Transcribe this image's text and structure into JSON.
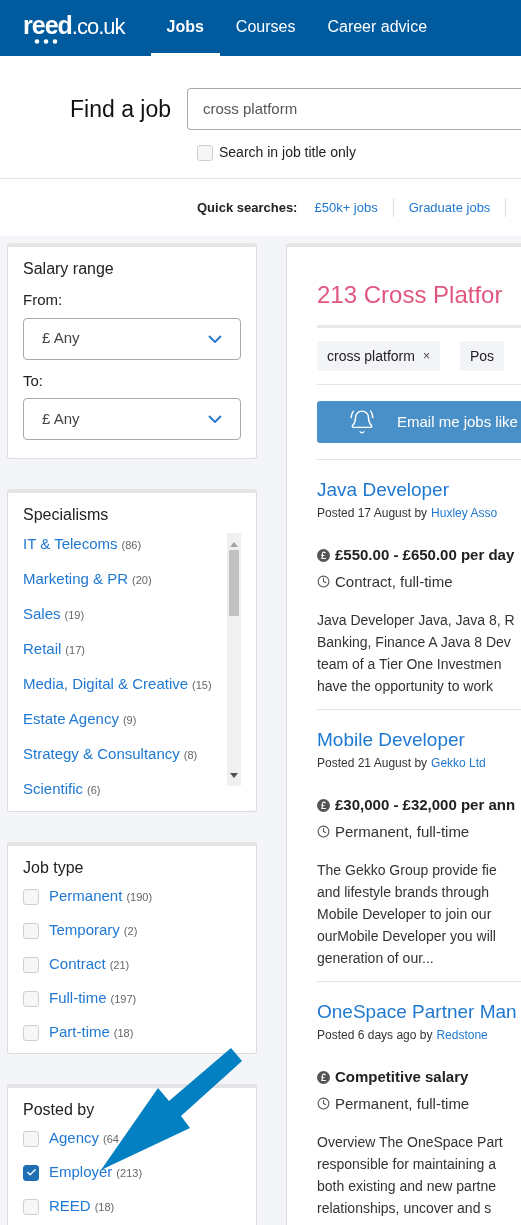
{
  "header": {
    "logo": {
      "main": "reed",
      "suffix": ".co.uk"
    },
    "nav": [
      {
        "label": "Jobs",
        "selected": true
      },
      {
        "label": "Courses",
        "selected": false
      },
      {
        "label": "Career advice",
        "selected": false
      }
    ]
  },
  "search": {
    "heading": "Find a job",
    "value": "cross platform",
    "title_only": {
      "label": "Search in job title only",
      "checked": false
    }
  },
  "quick_searches": {
    "label": "Quick searches:",
    "links": [
      "£50k+ jobs",
      "Graduate jobs"
    ]
  },
  "filters": [
    {
      "kind": "salary",
      "title": "Salary range",
      "selects": [
        {
          "label": "From:",
          "value": "£ Any"
        },
        {
          "label": "To:",
          "value": "£ Any"
        }
      ]
    },
    {
      "kind": "links",
      "title": "Specialisms",
      "items": [
        {
          "label": "IT & Telecoms",
          "count": "(86)"
        },
        {
          "label": "Marketing & PR",
          "count": "(20)"
        },
        {
          "label": "Sales",
          "count": "(19)"
        },
        {
          "label": "Retail",
          "count": "(17)"
        },
        {
          "label": "Media, Digital & Creative",
          "count": "(15)"
        },
        {
          "label": "Estate Agency",
          "count": "(9)"
        },
        {
          "label": "Strategy & Consultancy",
          "count": "(8)"
        },
        {
          "label": "Scientific",
          "count": "(6)"
        }
      ]
    },
    {
      "kind": "checks",
      "title": "Job type",
      "items": [
        {
          "label": "Permanent",
          "count": "(190)",
          "checked": false
        },
        {
          "label": "Temporary",
          "count": "(2)",
          "checked": false
        },
        {
          "label": "Contract",
          "count": "(21)",
          "checked": false
        },
        {
          "label": "Full-time",
          "count": "(197)",
          "checked": false
        },
        {
          "label": "Part-time",
          "count": "(18)",
          "checked": false
        }
      ]
    },
    {
      "kind": "checks",
      "title": "Posted by",
      "items": [
        {
          "label": "Agency",
          "count": "(64",
          "checked": false
        },
        {
          "label": "Employer",
          "count": "(213)",
          "checked": true
        },
        {
          "label": "REED",
          "count": "(18)",
          "checked": false
        }
      ]
    }
  ],
  "results": {
    "heading": "213 Cross Platfor",
    "tags": [
      {
        "label": "cross platform",
        "remove": "×"
      },
      {
        "label": "Pos"
      }
    ],
    "alert_button": "Email me jobs like",
    "jobs": [
      {
        "title": "Java Developer",
        "posted": "Posted 17 August by",
        "company": "Huxley Asso",
        "salary": "£550.00 - £650.00 per day",
        "type": "Contract, full-time",
        "description": [
          "Java Developer Java, Java 8, R",
          "Banking, Finance A Java 8 Dev",
          "team of a Tier One Investmen",
          "have the opportunity to work"
        ]
      },
      {
        "title": "Mobile Developer",
        "posted": "Posted 21 August by",
        "company": "Gekko Ltd",
        "salary": "£30,000 - £32,000 per ann",
        "type": "Permanent, full-time",
        "description": [
          "The Gekko Group provide fie",
          "and lifestyle brands through",
          "Mobile Developer to join our",
          "ourMobile Developer you will",
          "generation of our..."
        ]
      },
      {
        "title": "OneSpace Partner Man",
        "posted": "Posted 6 days ago by",
        "company": "Redstone",
        "salary": "Competitive salary",
        "type": "Permanent, full-time",
        "description": [
          "Overview The OneSpace Part",
          "responsible for maintaining a",
          "both existing and new partne",
          "relationships, uncover and s"
        ]
      }
    ]
  }
}
